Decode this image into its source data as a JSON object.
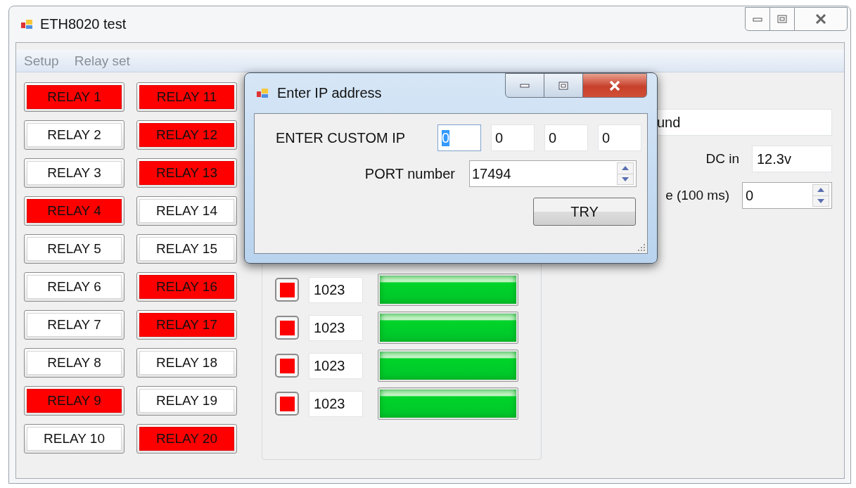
{
  "window": {
    "title": "ETH8020 test"
  },
  "menu": [
    {
      "label": "Setup"
    },
    {
      "label": "Relay set"
    }
  ],
  "relays": [
    {
      "label": "RELAY 1",
      "on": true
    },
    {
      "label": "RELAY 11",
      "on": true
    },
    {
      "label": "RELAY 2",
      "on": false
    },
    {
      "label": "RELAY 12",
      "on": true
    },
    {
      "label": "RELAY 3",
      "on": false
    },
    {
      "label": "RELAY 13",
      "on": true
    },
    {
      "label": "RELAY 4",
      "on": true
    },
    {
      "label": "RELAY 14",
      "on": false
    },
    {
      "label": "RELAY 5",
      "on": false
    },
    {
      "label": "RELAY 15",
      "on": false
    },
    {
      "label": "RELAY 6",
      "on": false
    },
    {
      "label": "RELAY 16",
      "on": true
    },
    {
      "label": "RELAY 7",
      "on": false
    },
    {
      "label": "RELAY 17",
      "on": true
    },
    {
      "label": "RELAY 8",
      "on": false
    },
    {
      "label": "RELAY 18",
      "on": false
    },
    {
      "label": "RELAY 9",
      "on": true
    },
    {
      "label": "RELAY 19",
      "on": false
    },
    {
      "label": "RELAY 10",
      "on": false
    },
    {
      "label": "RELAY 20",
      "on": true
    }
  ],
  "inputs": [
    {
      "on": true,
      "value": "1023",
      "level": 1
    },
    {
      "on": true,
      "value": "1023",
      "level": 1
    },
    {
      "on": true,
      "value": "1023",
      "level": 1
    },
    {
      "on": true,
      "value": "1023",
      "level": 1
    }
  ],
  "status": {
    "field_value": "und",
    "dc_label": "DC in",
    "dc_value": "12.3v",
    "timer_label": "e (100 ms)",
    "timer_value": "0"
  },
  "dialog": {
    "title": "Enter IP address",
    "ip_label": "ENTER CUSTOM IP",
    "ip_octets": [
      {
        "value": "0",
        "selected": true
      },
      {
        "value": "0",
        "selected": false
      },
      {
        "value": "0",
        "selected": false
      },
      {
        "value": "0",
        "selected": false
      }
    ],
    "port_label": "PORT number",
    "port_value": "17494",
    "button": "TRY"
  }
}
